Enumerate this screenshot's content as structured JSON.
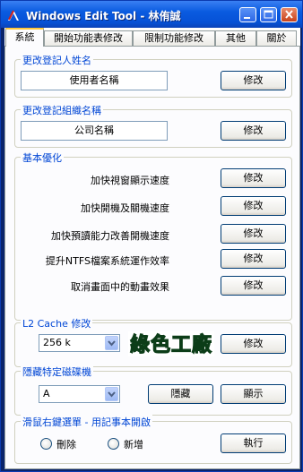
{
  "window": {
    "title": "Windows Edit Tool - 林侑誠"
  },
  "tabs": [
    "系統",
    "開始功能表修改",
    "限制功能修改",
    "其他",
    "關於"
  ],
  "owner": {
    "group_label": "更改登記人姓名",
    "value": "使用者名稱",
    "button": "修改"
  },
  "org": {
    "group_label": "更改登記組織名稱",
    "value": "公司名稱",
    "button": "修改"
  },
  "optimize": {
    "group_label": "基本優化",
    "items": [
      {
        "label": "加快視窗顯示速度",
        "button": "修改"
      },
      {
        "label": "加快開機及關機速度",
        "button": "修改"
      },
      {
        "label": "加快預讀能力改善開機速度",
        "button": "修改"
      },
      {
        "label": "提升NTFS檔案系統運作效率",
        "button": "修改"
      },
      {
        "label": "取消畫面中的動畫效果",
        "button": "修改"
      }
    ]
  },
  "cache": {
    "group_label": "L2 Cache 修改",
    "selected": "256 k",
    "logo_text": "綠色工廠",
    "button": "修改"
  },
  "drive": {
    "group_label": "隱藏特定磁碟機",
    "selected": "A",
    "hide_button": "隱藏",
    "show_button": "顯示"
  },
  "context": {
    "group_label": "滑鼠右鍵選單 - 用記事本開啟",
    "radio_delete": "刪除",
    "radio_add": "新增",
    "run_button": "執行"
  },
  "icons": {
    "app": "red-pen-icon",
    "minimize": "minimize-icon",
    "maximize": "maximize-icon",
    "close": "close-icon",
    "dropdown": "chevron-down-icon"
  },
  "colors": {
    "titlebar": "#0a5be0",
    "group_label": "#0046d5",
    "logo": "#1e8a3c"
  }
}
